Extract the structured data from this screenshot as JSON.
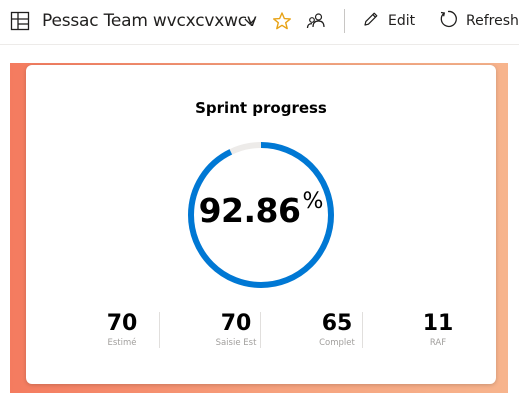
{
  "header": {
    "team_name": "Pessac Team wvcxcvxwcv",
    "edit_label": "Edit",
    "refresh_label": "Refresh",
    "icons": [
      "board-icon",
      "chevron-down-icon",
      "star-icon",
      "people-icon",
      "pencil-icon",
      "refresh-icon"
    ]
  },
  "widget": {
    "title": "Sprint progress",
    "progress_value": "92.86",
    "progress_unit": "%",
    "progress_fraction": 0.9286,
    "gauge_color": "#0078d4",
    "gauge_track_color": "#edebe9",
    "background_gradient": [
      "#f47b5f",
      "#f7b48d"
    ],
    "stats": [
      {
        "value": "70",
        "label": "Estimé"
      },
      {
        "value": "70",
        "label": "Saisie Est"
      },
      {
        "value": "65",
        "label": "Complet"
      },
      {
        "value": "11",
        "label": "RAF"
      }
    ]
  }
}
